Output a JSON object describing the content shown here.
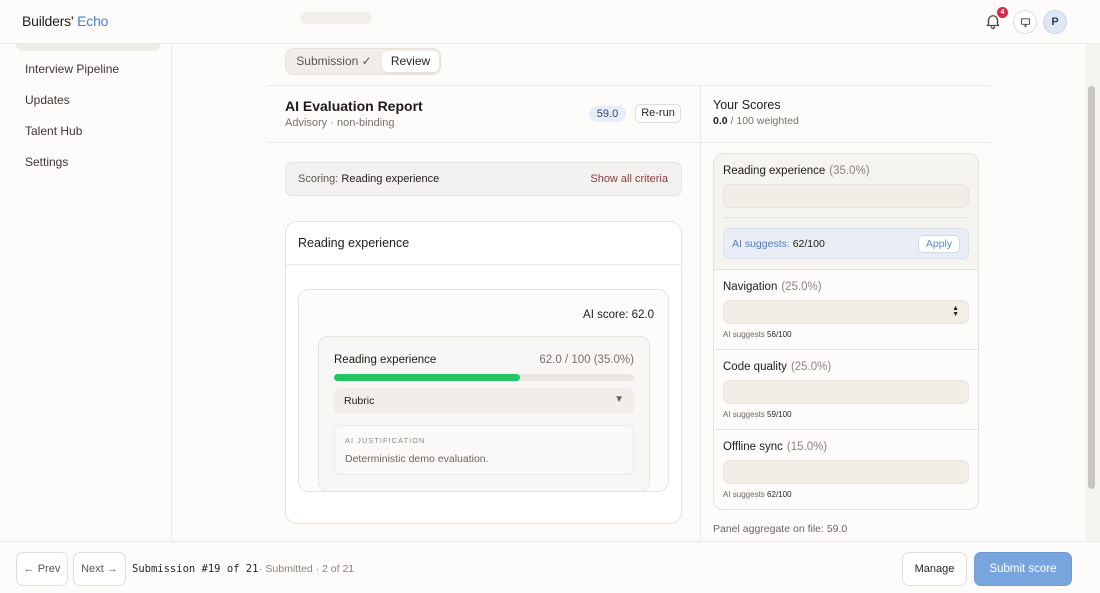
{
  "brand": {
    "part1": "Builders'",
    "part2": "Echo"
  },
  "header": {
    "notification_count": "4",
    "avatar_initial": "P"
  },
  "sidebar": {
    "items": [
      {
        "label": "Interview Pipeline"
      },
      {
        "label": "Updates"
      },
      {
        "label": "Talent Hub"
      },
      {
        "label": "Settings"
      }
    ]
  },
  "tabs": {
    "submission": "Submission ✓",
    "review": "Review"
  },
  "report": {
    "title": "AI Evaluation Report",
    "subtitle": "Advisory · non-binding",
    "score": "59.0",
    "rerun_label": "Re-run"
  },
  "scoring": {
    "prefix": "Scoring:",
    "criterion": "Reading experience",
    "show_all": "Show all criteria"
  },
  "criterion_card": {
    "title": "Reading experience",
    "ai_score": "AI score: 62.0",
    "detail_name": "Reading experience",
    "detail_value": "62.0 / 100 (35.0%)",
    "progress_fraction": 0.62,
    "rubric_label": "Rubric",
    "justification_label": "AI JUSTIFICATION",
    "justification_text": "Deterministic demo evaluation."
  },
  "your_scores": {
    "title": "Your Scores",
    "total": "0.0",
    "suffix": "/ 100 weighted",
    "criteria": [
      {
        "name": "Reading experience",
        "weight": "(35.0%)",
        "suggest_prefix": "AI suggests:",
        "suggest_value": "62/100",
        "apply_label": "Apply"
      },
      {
        "name": "Navigation",
        "weight": "(25.0%)",
        "suggest_prefix": "AI suggests",
        "suggest_value": "56/100"
      },
      {
        "name": "Code quality",
        "weight": "(25.0%)",
        "suggest_prefix": "AI suggests",
        "suggest_value": "59/100"
      },
      {
        "name": "Offline sync",
        "weight": "(15.0%)",
        "suggest_prefix": "AI suggests",
        "suggest_value": "62/100"
      }
    ],
    "panel_aggregate": "Panel aggregate on file: 59.0"
  },
  "footer": {
    "prev_label": "← Prev",
    "next_label": "Next →",
    "submission_id": "Submission #19 of 21",
    "submitted_meta": "· Submitted · 2 of 21",
    "manage_label": "Manage",
    "submit_label": "Submit score"
  },
  "colors": {
    "accent": "#79a5de",
    "progress": "#24c467",
    "badge": "#d6284b"
  }
}
